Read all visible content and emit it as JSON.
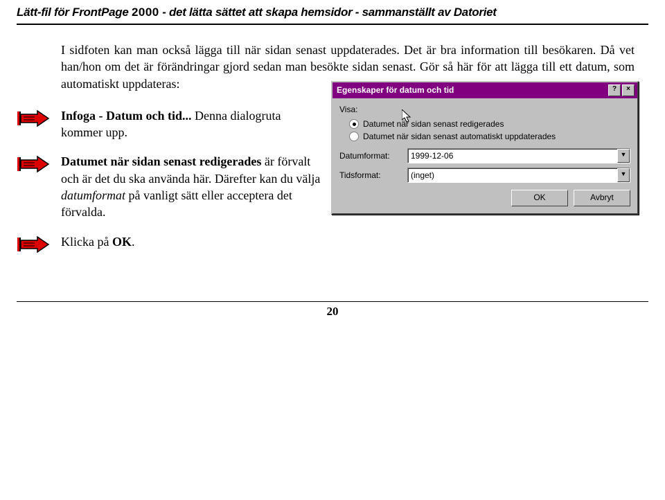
{
  "header": {
    "title_prefix": "Lätt-fil för FrontPage ",
    "title_year": "2000",
    "title_mid": " - det lätta sättet att skapa hemsidor - sammanställt av ",
    "brand": "Datoriet"
  },
  "para_intro": "I sidfoten kan man också lägga till när sidan senast uppdaterades. Det är bra information till besökaren. Då vet han/hon om det är förändringar gjord sedan man besökte sidan senast. Gör så här för att lägga till ett datum, som automatiskt uppdateras:",
  "step1_prefix_bold": "Infoga - Datum och tid...",
  "step1_rest": " Denna dialogruta kommer upp.",
  "step2_bold": "Datumet när sidan senast redigerades",
  "step2_mid": " är förvalt och är det du ska använda här. Därefter kan du välja ",
  "step2_italic": "datumformat",
  "step2_end": " på vanligt sätt eller acceptera det förvalda.",
  "step3_prefix": "Klicka på ",
  "step3_bold": "OK",
  "step3_suffix": ".",
  "dialog": {
    "title": "Egenskaper för datum och tid",
    "help_btn": "?",
    "close_btn": "×",
    "show_label": "Visa:",
    "radio1": "Datumet när sidan senast redigerades",
    "radio2": "Datumet när sidan senast automatiskt uppdaterades",
    "field_date_label": "Datumformat:",
    "field_date_value": "1999-12-06",
    "field_time_label": "Tidsformat:",
    "field_time_value": "(inget)",
    "ok": "OK",
    "cancel": "Avbryt"
  },
  "page_number": "20"
}
